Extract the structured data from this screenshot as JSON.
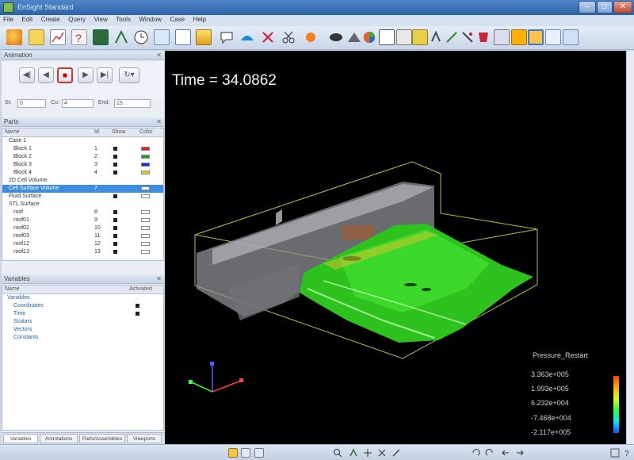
{
  "window": {
    "title": "EnSight Standard"
  },
  "menu": [
    "File",
    "Edit",
    "Create",
    "Query",
    "View",
    "Tools",
    "Window",
    "Case",
    "Help"
  ],
  "toolbar_icons": [
    "parts-icon",
    "table-icon",
    "plot-icon",
    "query-icon",
    "monitor-icon",
    "vector-icon",
    "clock-icon",
    "book-icon",
    "clip-icon",
    "color-icon",
    "annotate-icon",
    "surface-icon",
    "shape-icon",
    "cut-icon",
    "probe-icon",
    "shade-icon",
    "palette-icon",
    "hide-icon",
    "transparency-icon",
    "cube-icon",
    "arrow-icon",
    "pick-icon",
    "ruler-icon",
    "measure-icon",
    "bucket-icon",
    "camera-icon",
    "frame-icon"
  ],
  "animation": {
    "panel_title": "Animation",
    "start_label": "St:",
    "start_value": "0",
    "current_label": "Cu:",
    "current_value": "4",
    "end_label": "End:",
    "end_value": "15"
  },
  "parts": {
    "panel_title": "Parts",
    "columns": [
      "Name",
      "Id",
      "Show",
      "Color"
    ],
    "rows": [
      {
        "name": "Case 1",
        "id": "",
        "show": false,
        "color": ""
      },
      {
        "name": "Block 1",
        "id": "1",
        "show": true,
        "color": "#e02020"
      },
      {
        "name": "Block 2",
        "id": "2",
        "show": true,
        "color": "#2a9a2a"
      },
      {
        "name": "Block 3",
        "id": "3",
        "show": true,
        "color": "#2030d0"
      },
      {
        "name": "Block 4",
        "id": "4",
        "show": true,
        "color": "#e0d020"
      },
      {
        "name": "2D Cell Volume",
        "id": "",
        "show": false,
        "color": ""
      },
      {
        "name": "Cell Surface Volume",
        "id": "7",
        "show": false,
        "color": "#ffffff"
      },
      {
        "name": "Fluid Surface",
        "id": "",
        "show": true,
        "color": "#ffffff"
      },
      {
        "name": "STL Surface",
        "id": "",
        "show": false,
        "color": ""
      },
      {
        "name": "roof",
        "id": "8",
        "show": true,
        "color": "#ffffff"
      },
      {
        "name": "roof01",
        "id": "9",
        "show": true,
        "color": "#ffffff"
      },
      {
        "name": "roof02",
        "id": "10",
        "show": true,
        "color": "#ffffff"
      },
      {
        "name": "roof03",
        "id": "11",
        "show": true,
        "color": "#ffffff"
      },
      {
        "name": "roof12",
        "id": "12",
        "show": true,
        "color": "#ffffff"
      },
      {
        "name": "roof13",
        "id": "13",
        "show": true,
        "color": "#ffffff"
      }
    ]
  },
  "variables": {
    "panel_title": "Variables",
    "columns": [
      "Name",
      "Activated"
    ],
    "rows": [
      "Variables",
      "Coordinates",
      "Time",
      "Scalars",
      "Vectors",
      "Constants"
    ]
  },
  "bottom_tabs": [
    "Variables",
    "Annotations",
    "Parts/Assemblies",
    "Viewports"
  ],
  "viewport": {
    "time_label": "Time = 34.0862",
    "legend_title": "Pressure_Restart",
    "legend_values": [
      "3.363e+005",
      "1.993e+005",
      "6.232e+004",
      "-7.468e+004",
      "-2.117e+005"
    ]
  },
  "status_icons": [
    "select-icon",
    "grid-icon",
    "zoom-icon",
    "rotate-icon",
    "translate-icon",
    "undo-icon",
    "redo-icon",
    "help-icon"
  ]
}
